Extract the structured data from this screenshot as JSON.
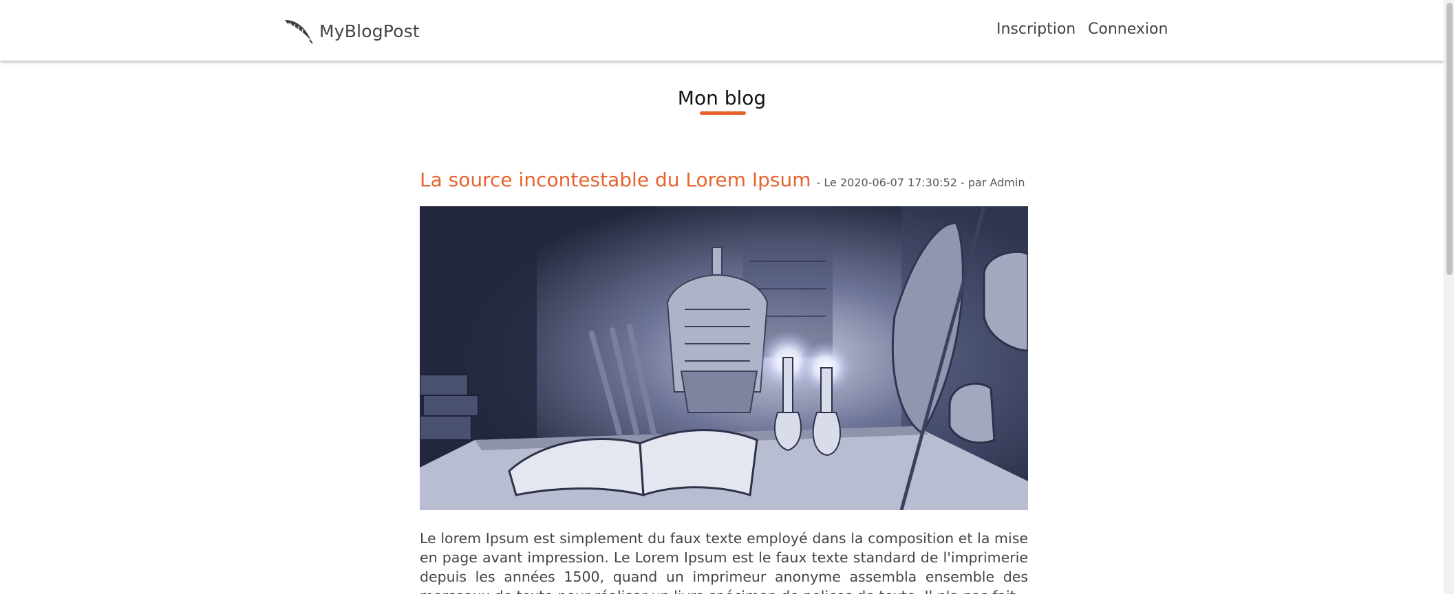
{
  "header": {
    "brand": "MyBlogPost",
    "logo_icon": "quill-feather-icon",
    "nav": {
      "signup": "Inscription",
      "login": "Connexion"
    }
  },
  "main": {
    "section_title": "Mon blog",
    "accent_color": "#e8622d",
    "post": {
      "title": "La source incontestable du Lorem Ipsum",
      "meta": "- Le 2020-06-07 17:30:52 - par Admin",
      "image_alt": "Illustration : salle d'armes médiévale avec armure, livre ouvert et bougies",
      "excerpt": "Le lorem Ipsum est simplement du faux texte employé dans la composition et la mise en page avant impression. Le Lorem Ipsum est le faux texte standard de l'imprimerie depuis les années 1500, quand un imprimeur anonyme assembla ensemble des morceaux de texte pour réaliser un livre spécimen de polices de texte. Il n'a pas fait"
    }
  }
}
